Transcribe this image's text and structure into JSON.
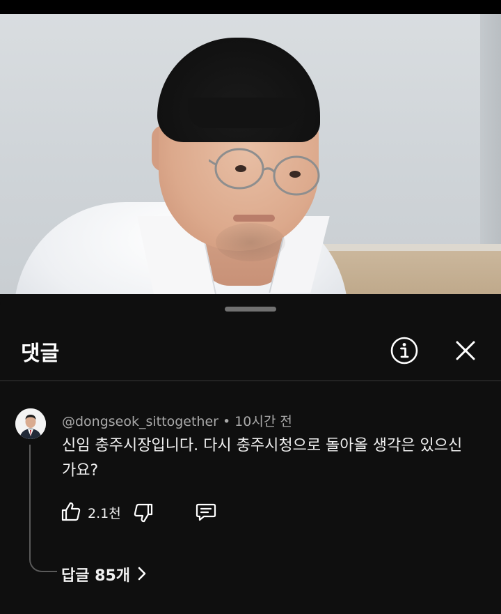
{
  "sheet": {
    "title": "댓글",
    "info_icon": "info-circle-icon",
    "close_icon": "close-icon"
  },
  "comment": {
    "author": "@dongseok_sittogether",
    "separator": "•",
    "time": "10시간 전",
    "text": "신임 충주시장입니다. 다시 충주시청으로 돌아올 생각은 있으신가요?",
    "likes": "2.1천",
    "replies_label": "답글 85개"
  },
  "colors": {
    "background": "#0f0f0f",
    "text_primary": "#f1f1f1",
    "text_secondary": "#aaaaaa",
    "divider": "#3a3a3a"
  }
}
